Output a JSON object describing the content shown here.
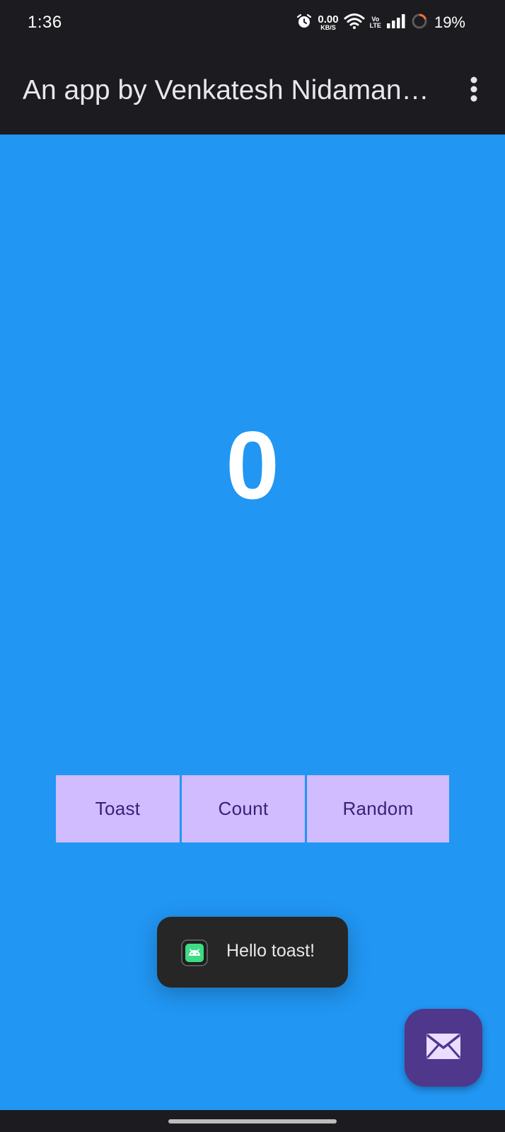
{
  "status_bar": {
    "time": "1:36",
    "net_speed_value": "0.00",
    "net_speed_unit": "KB/S",
    "volte_top": "Vo",
    "volte_bottom": "LTE",
    "battery_percent": "19%",
    "icons": [
      "alarm-icon",
      "wifi-icon",
      "signal-icon",
      "battery-icon"
    ]
  },
  "app_bar": {
    "title": "An app by Venkatesh Nidamanuru",
    "menu_icon": "more-vert-icon"
  },
  "main": {
    "counter": "0",
    "background_color": "#2196f3",
    "buttons": [
      {
        "label": "Toast"
      },
      {
        "label": "Count"
      },
      {
        "label": "Random"
      }
    ]
  },
  "toast": {
    "message": "Hello toast!",
    "icon": "android-app-icon"
  },
  "fab": {
    "icon": "email-icon",
    "color": "#4f378b"
  },
  "colors": {
    "button_bg": "#d0bcff",
    "button_text": "#3b1f78",
    "bar_bg": "#1c1b1f"
  }
}
